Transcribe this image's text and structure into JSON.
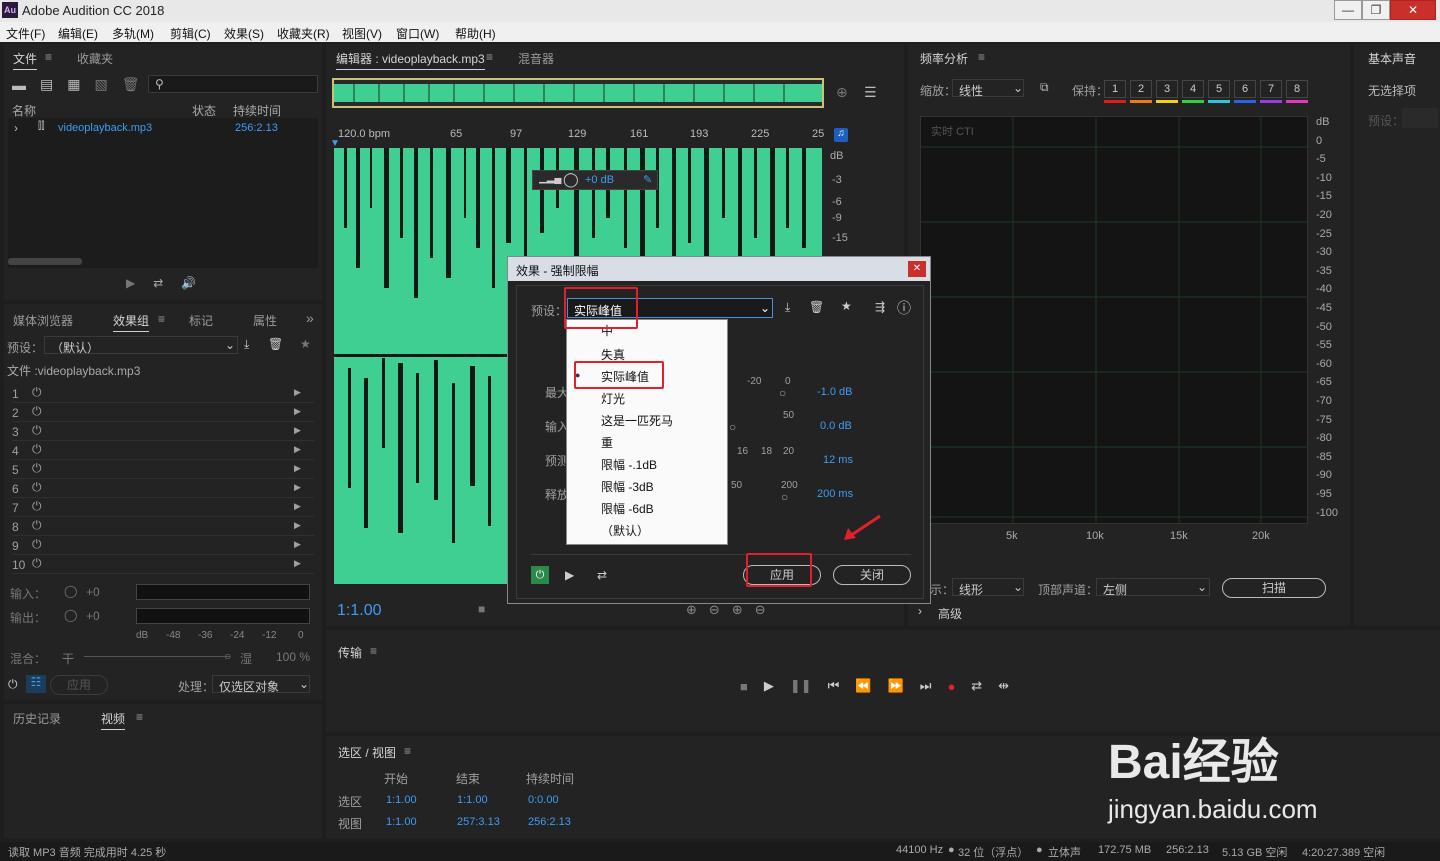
{
  "titlebar": {
    "logo": "Au",
    "title": "Adobe Audition CC 2018",
    "min": "—",
    "max": "❐",
    "close": "✕"
  },
  "menu": [
    "文件(F)",
    "编辑(E)",
    "多轨(M)",
    "剪辑(C)",
    "效果(S)",
    "收藏夹(R)",
    "视图(V)",
    "窗口(W)",
    "帮助(H)"
  ],
  "files_panel": {
    "tab_files": "文件",
    "tab_fav": "收藏夹",
    "col_name": "名称",
    "col_status": "状态",
    "col_duration": "持续时间",
    "file_name": "videoplayback.mp3",
    "file_duration": "256:2.13"
  },
  "effects_panel": {
    "tabs": [
      "媒体浏览器",
      "效果组",
      "标记",
      "属性"
    ],
    "preset_label": "预设：",
    "preset_value": "（默认）",
    "file_label": "文件 :videoplayback.mp3",
    "rows": [
      "1",
      "2",
      "3",
      "4",
      "5",
      "6",
      "7",
      "8",
      "9",
      "10"
    ],
    "input_label": "输入：",
    "output_label": "输出：",
    "plus0": "+0",
    "meter_scale": [
      "dB",
      "-48",
      "-36",
      "-24",
      "-12",
      "0"
    ],
    "mix_label": "混合：",
    "dry": "干",
    "wet": "湿",
    "mix_pct": "100 %",
    "apply": "应用",
    "process_label": "处理：",
    "process_value": "仅选区对象"
  },
  "history_panel": {
    "tab_history": "历史记录",
    "tab_video": "视频"
  },
  "editor": {
    "tab_editor": "编辑器 : videoplayback.mp3",
    "tab_mixer": "混音器",
    "ruler": [
      "120.0 bpm",
      "65",
      "97",
      "129",
      "161",
      "193",
      "225",
      "25"
    ],
    "db_labels": [
      "dB",
      "-3",
      "-6",
      "-9",
      "-15"
    ],
    "hud_gain": "+0 dB",
    "time": "1:1.00"
  },
  "dialog": {
    "title": "效果 - 强制限幅",
    "preset_label": "预设：",
    "preset_value": "实际峰值",
    "params": [
      {
        "label": "最大",
        "scale": [
          "-20",
          "0"
        ],
        "value": "-1.0 dB"
      },
      {
        "label": "输入",
        "scale": [
          "50"
        ],
        "value": "0.0 dB"
      },
      {
        "label": "预测",
        "scale": [
          "16",
          "18",
          "20"
        ],
        "value": "12 ms"
      },
      {
        "label": "释放",
        "scale": [
          "50",
          "200"
        ],
        "value": "200 ms"
      }
    ],
    "apply": "应用",
    "close": "关闭",
    "close_x": "✕"
  },
  "dropdown": {
    "items": [
      "中",
      "失真",
      "实际峰值",
      "灯光",
      "这是一匹死马",
      "重",
      "限幅 -.1dB",
      "限幅 -3dB",
      "限幅 -6dB",
      "（默认）"
    ],
    "selected": "实际峰值"
  },
  "spectrum": {
    "title": "频率分析",
    "zoom_label": "缩放：",
    "zoom_value": "线性",
    "hold_label": "保持：",
    "holds": [
      "1",
      "2",
      "3",
      "4",
      "5",
      "6",
      "7",
      "8"
    ],
    "hold_colors": [
      "#e21a1a",
      "#ef7a12",
      "#f0d21a",
      "#2ad43a",
      "#27c9d8",
      "#2b63e8",
      "#9b3ce8",
      "#e23ab8"
    ],
    "cti": "实时 CTI",
    "db_scale": [
      "dB",
      "0",
      "-5",
      "-10",
      "-15",
      "-20",
      "-25",
      "-30",
      "-35",
      "-40",
      "-45",
      "-50",
      "-55",
      "-60",
      "-65",
      "-70",
      "-75",
      "-80",
      "-85",
      "-90",
      "-95",
      "-100"
    ],
    "freq_scale": [
      "5k",
      "10k",
      "15k",
      "20k"
    ],
    "display_label": "示：",
    "display_value": "线形",
    "channel_label": "顶部声道：",
    "channel_value": "左侧",
    "scan": "扫描",
    "advanced": "高级"
  },
  "essential": {
    "title": "基本声音",
    "no_selection": "无选择项",
    "preset": "预设："
  },
  "transport": {
    "title": "传输"
  },
  "selview": {
    "title": "选区 / 视图",
    "cols": [
      "开始",
      "结束",
      "持续时间"
    ],
    "rows": [
      {
        "label": "选区",
        "start": "1:1.00",
        "end": "1:1.00",
        "dur": "0:0.00"
      },
      {
        "label": "视图",
        "start": "1:1.00",
        "end": "257:3.13",
        "dur": "256:2.13"
      }
    ]
  },
  "status": {
    "left": "读取 MP3 音频 完成用时 4.25 秒",
    "rate": "44100 Hz",
    "bits": "32 位（浮点）",
    "channel": "立体声",
    "mem": "172.75 MB",
    "dur": "256:2.13",
    "free": "5.13 GB 空闲",
    "time_free": "4:20:27.389 空闲"
  },
  "watermark": {
    "brand": "Bai经验",
    "url": "jingyan.baidu.com"
  }
}
